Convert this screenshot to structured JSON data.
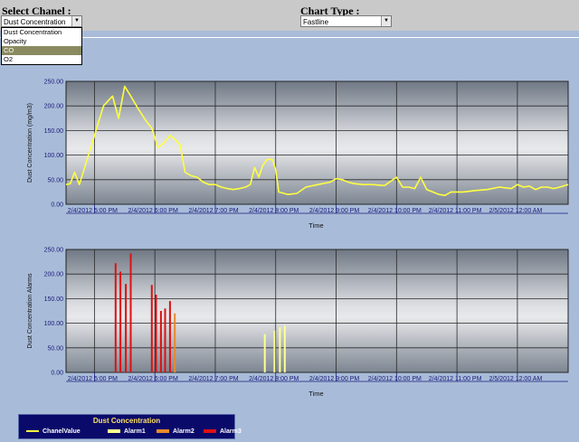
{
  "header": {
    "channel_label": "Select Chanel :",
    "channel_selected": "Dust Concentration",
    "chart_type_label": "Chart Type :",
    "chart_type_selected": "Fastline"
  },
  "channel_dropdown": {
    "options": [
      "Dust Concentration",
      "Opacity",
      "CO",
      "O2"
    ],
    "highlighted": "CO"
  },
  "colors": {
    "background": "#a8bcd9",
    "chanel_value": "#ffff40",
    "alarm1": "#ffff90",
    "alarm2": "#e88a2a",
    "alarm3": "#dd1111"
  },
  "chart_data": [
    {
      "type": "line",
      "ylabel": "Dust Concentration (mg/m3)",
      "xlabel": "Time",
      "ylim": [
        0,
        250
      ],
      "y_ticks": [
        "250.00",
        "200.00",
        "150.00",
        "100.00",
        "50.00",
        "0.00"
      ],
      "x_ticks": [
        "2/4/2012 5:00 PM",
        "2/4/2012 6:00 PM",
        "2/4/2012 7:00 PM",
        "2/4/2012 8:00 PM",
        "2/4/2012 9:00 PM",
        "2/4/2012 10:00 PM",
        "2/4/2012 11:00 PM",
        "2/5/2012 12:00 AM"
      ],
      "x_tick_hours": [
        17,
        18,
        19,
        20,
        21,
        22,
        23,
        24
      ],
      "xlim_hours": [
        16.53,
        24.84
      ],
      "grid": true,
      "series": [
        {
          "name": "ChanelValue",
          "x_hours": [
            16.53,
            16.6,
            16.67,
            16.75,
            16.85,
            16.95,
            17.05,
            17.15,
            17.3,
            17.4,
            17.5,
            17.6,
            17.72,
            17.85,
            17.95,
            18.0,
            18.05,
            18.15,
            18.25,
            18.35,
            18.42,
            18.5,
            18.6,
            18.7,
            18.8,
            18.9,
            19.0,
            19.1,
            19.2,
            19.3,
            19.4,
            19.5,
            19.58,
            19.65,
            19.72,
            19.78,
            19.85,
            19.9,
            19.95,
            20.0,
            20.05,
            20.2,
            20.35,
            20.5,
            20.7,
            20.9,
            21.0,
            21.1,
            21.2,
            21.3,
            21.45,
            21.6,
            21.8,
            22.0,
            22.1,
            22.2,
            22.3,
            22.4,
            22.5,
            22.6,
            22.7,
            22.8,
            22.9,
            23.0,
            23.1,
            23.3,
            23.5,
            23.7,
            23.9,
            24.0,
            24.1,
            24.2,
            24.3,
            24.4,
            24.5,
            24.6,
            24.7,
            24.84
          ],
          "values": [
            40,
            42,
            65,
            40,
            80,
            120,
            160,
            200,
            220,
            175,
            240,
            220,
            195,
            170,
            155,
            135,
            115,
            125,
            140,
            130,
            120,
            65,
            58,
            55,
            45,
            40,
            40,
            35,
            32,
            30,
            32,
            35,
            40,
            75,
            55,
            78,
            90,
            92,
            90,
            70,
            25,
            20,
            22,
            35,
            40,
            45,
            52,
            50,
            45,
            42,
            40,
            40,
            38,
            55,
            35,
            35,
            32,
            55,
            30,
            25,
            20,
            18,
            25,
            25,
            25,
            28,
            30,
            35,
            32,
            40,
            35,
            37,
            30,
            35,
            35,
            32,
            35,
            40
          ]
        }
      ]
    },
    {
      "type": "bar",
      "ylabel": "Dust Concentration Alarms",
      "xlabel": "Time",
      "ylim": [
        0,
        250
      ],
      "y_ticks": [
        "250.00",
        "200.00",
        "150.00",
        "100.00",
        "50.00",
        "0.00"
      ],
      "x_ticks": [
        "2/4/2012 5:00 PM",
        "2/4/2012 6:00 PM",
        "2/4/2012 7:00 PM",
        "2/4/2012 8:00 PM",
        "2/4/2012 9:00 PM",
        "2/4/2012 10:00 PM",
        "2/4/2012 11:00 PM",
        "2/5/2012 12:00 AM"
      ],
      "x_tick_hours": [
        17,
        18,
        19,
        20,
        21,
        22,
        23,
        24
      ],
      "xlim_hours": [
        16.53,
        24.84
      ],
      "grid": true,
      "series": [
        {
          "name": "Alarm1",
          "x_hours": [
            19.82,
            19.98,
            20.07,
            20.15
          ],
          "values": [
            78,
            85,
            92,
            95
          ]
        },
        {
          "name": "Alarm2",
          "x_hours": [
            18.33
          ],
          "values": [
            120
          ]
        },
        {
          "name": "Alarm3",
          "x_hours": [
            17.35,
            17.43,
            17.52,
            17.6,
            17.95,
            18.02,
            18.1,
            18.17,
            18.25
          ],
          "values": [
            222,
            205,
            180,
            242,
            178,
            158,
            125,
            130,
            145
          ]
        }
      ]
    }
  ],
  "legend": {
    "title": "Dust Concentration",
    "items": [
      "ChanelValue",
      "Alarm1",
      "Alarm2",
      "Alarm3"
    ]
  }
}
